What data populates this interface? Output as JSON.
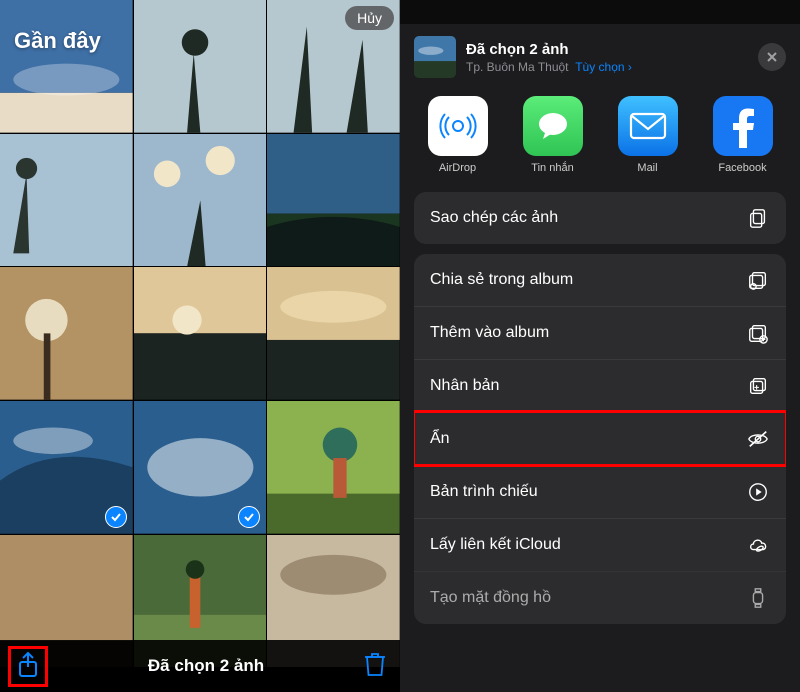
{
  "left": {
    "title": "Gần đây",
    "cancel": "Hủy",
    "selected_label": "Đã chọn 2 ảnh"
  },
  "right": {
    "header": {
      "title": "Đã chọn 2 ảnh",
      "location": "Tp. Buôn Ma Thuột",
      "options": "Tùy chọn"
    },
    "apps": [
      {
        "label": "AirDrop",
        "color": "#ffffff"
      },
      {
        "label": "Tin nhắn",
        "color": "#2fd158"
      },
      {
        "label": "Mail",
        "color": "#1fa7ff"
      },
      {
        "label": "Facebook",
        "color": "#1877f2"
      }
    ],
    "groups": [
      {
        "rows": [
          {
            "label": "Sao chép các ảnh",
            "icon": "copy"
          }
        ],
        "highlight": false
      },
      {
        "rows": [
          {
            "label": "Chia sẻ trong album",
            "icon": "shared-album"
          },
          {
            "label": "Thêm vào album",
            "icon": "add-album"
          },
          {
            "label": "Nhân bản",
            "icon": "duplicate"
          },
          {
            "label": "Ẩn",
            "icon": "hide",
            "highlight": true
          },
          {
            "label": "Bản trình chiếu",
            "icon": "play"
          },
          {
            "label": "Lấy liên kết iCloud",
            "icon": "icloud-link"
          },
          {
            "label": "Tạo mặt đồng hồ",
            "icon": "watch"
          }
        ]
      }
    ]
  }
}
